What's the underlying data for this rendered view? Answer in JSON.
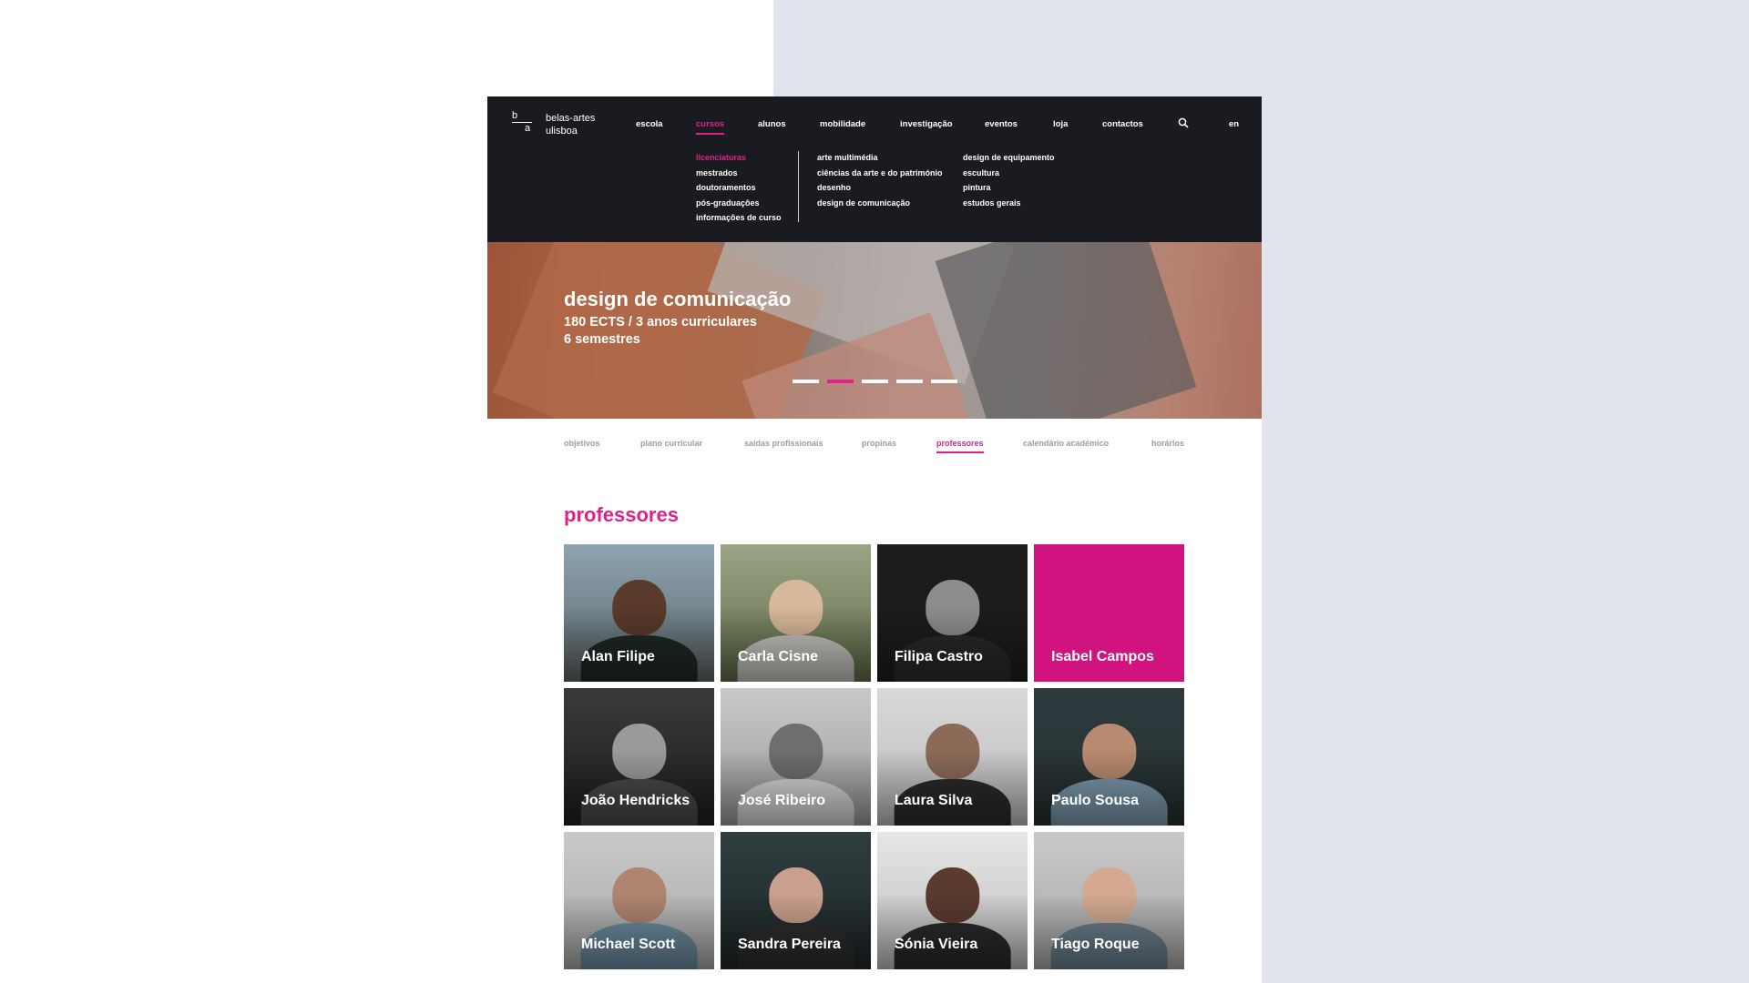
{
  "header": {
    "logo": {
      "b": "b",
      "a": "a"
    },
    "brand_line1": "belas-artes",
    "brand_line2": "ulisboa",
    "nav": [
      "escola",
      "cursos",
      "alunos",
      "mobilidade",
      "investigação",
      "eventos",
      "loja",
      "contactos"
    ],
    "active_nav": "cursos",
    "language": "en",
    "search_icon": "search-icon"
  },
  "submenu": {
    "types": [
      "licenciaturas",
      "mestrados",
      "doutoramentos",
      "pós-graduações",
      "informações de curso"
    ],
    "active_type": "licenciaturas",
    "courses_col1": [
      "arte multimédia",
      "ciências da arte e do património",
      "desenho",
      "design de comunicação"
    ],
    "courses_col2": [
      "design de equipamento",
      "escultura",
      "pintura",
      "estudos gerais"
    ]
  },
  "hero": {
    "title": "design de comunicação",
    "line1": "180 ECTS / 3 anos curriculares",
    "line2": "6 semestres",
    "slides_total": 5,
    "active_slide": 2
  },
  "tabs": {
    "items": [
      "objetivos",
      "plano curricular",
      "saídas profissionais",
      "propinas",
      "professores",
      "calendário académico",
      "horários"
    ],
    "active": "professores"
  },
  "section_title": "professores",
  "professors": [
    {
      "name": "Alan Filipe"
    },
    {
      "name": "Carla Cisne"
    },
    {
      "name": "Filipa Castro"
    },
    {
      "name": "Isabel Campos"
    },
    {
      "name": "João Hendricks"
    },
    {
      "name": "José Ribeiro"
    },
    {
      "name": "Laura Silva"
    },
    {
      "name": "Paulo Sousa"
    },
    {
      "name": "Michael Scott"
    },
    {
      "name": "Sandra Pereira"
    },
    {
      "name": "Sónia Vieira"
    },
    {
      "name": "Tiago Roque"
    }
  ],
  "colors": {
    "accent": "#e0218a",
    "header_bg": "#1a1b20",
    "highlight_card": "#d1137f",
    "page_bg_right": "#e1e4ec"
  }
}
